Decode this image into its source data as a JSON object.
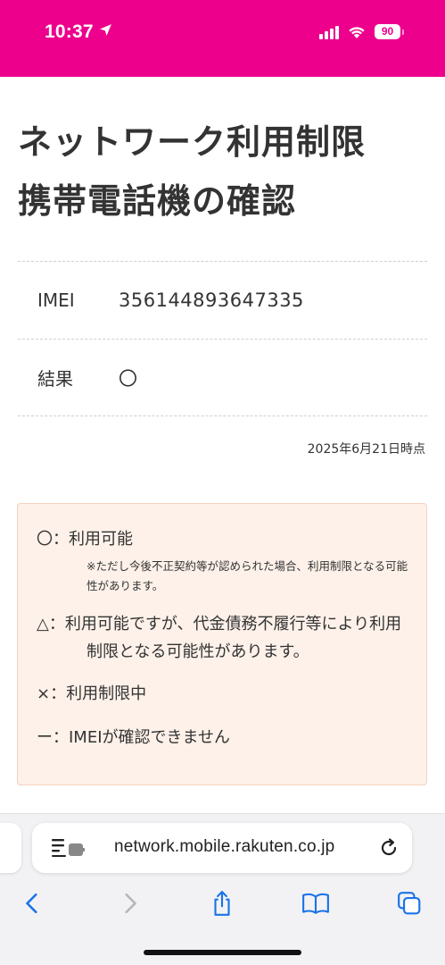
{
  "status_bar": {
    "time": "10:37",
    "battery": "90",
    "background_color": "#ec008c"
  },
  "page": {
    "title_line1": "ネットワーク利用制限",
    "title_line2": "携帯電話機の確認"
  },
  "info": {
    "imei_label": "IMEI",
    "imei_value": "356144893647335",
    "result_label": "結果",
    "result_value": "〇"
  },
  "timestamp": "2025年6月21日時点",
  "legend": {
    "available": "〇：利用可能",
    "available_note": "※ただし今後不正契約等が認められた場合、利用制限となる可能性があります。",
    "triangle": "△：利用可能ですが、代金債務不履行等により利用制限となる可能性があります。",
    "restricted": "×：利用制限中",
    "unknown": "ー：IMEIが確認できません",
    "background_color": "#fdf1e9"
  },
  "browser": {
    "url": "network.mobile.rakuten.co.jp",
    "icons": {
      "page": "page-settings-icon",
      "reload": "reload-icon",
      "back": "back-icon",
      "forward": "forward-icon",
      "share": "share-icon",
      "bookmarks": "bookmarks-icon",
      "tabs": "tabs-icon"
    },
    "accent_color": "#1a73e8"
  }
}
